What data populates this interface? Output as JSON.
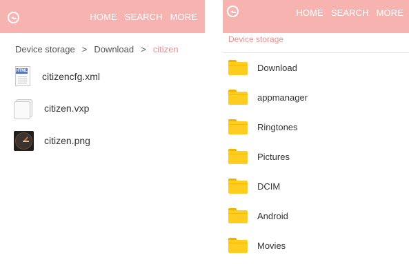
{
  "left": {
    "nav": {
      "home": "HOME",
      "search": "SEARCH",
      "more": "MORE"
    },
    "breadcrumb": {
      "root": "Device storage",
      "folder": "Download",
      "current": "citizen",
      "separator": ">"
    },
    "files": [
      {
        "name": "citizencfg.xml",
        "icon": "html-file-icon",
        "badge": "HTML"
      },
      {
        "name": "citizen.vxp",
        "icon": "blank-file-icon"
      },
      {
        "name": "citizen.png",
        "icon": "image-thumbnail-icon"
      }
    ]
  },
  "right": {
    "nav": {
      "home": "HOME",
      "search": "SEARCH",
      "more": "MORE"
    },
    "breadcrumb": {
      "root": "Device storage"
    },
    "folders": [
      {
        "name": "Download"
      },
      {
        "name": "appmanager"
      },
      {
        "name": "Ringtones"
      },
      {
        "name": "Pictures"
      },
      {
        "name": "DCIM"
      },
      {
        "name": "Android"
      },
      {
        "name": "Movies"
      }
    ]
  },
  "colors": {
    "header": "#f7b3b0",
    "accent": "#f38c88",
    "folder": "#ffcd1f"
  }
}
